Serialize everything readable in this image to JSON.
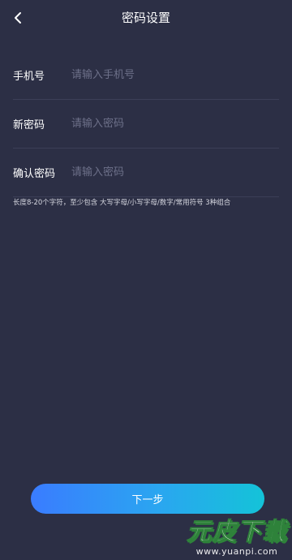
{
  "header": {
    "title": "密码设置",
    "back_icon": "chevron-left-icon"
  },
  "form": {
    "phone": {
      "label": "手机号",
      "placeholder": "请输入手机号",
      "value": ""
    },
    "new_password": {
      "label": "新密码",
      "placeholder": "请输入密码",
      "value": ""
    },
    "confirm_password": {
      "label": "确认密码",
      "placeholder": "请输入密码",
      "value": ""
    }
  },
  "hint": "长度8-20个字符，至少包含 大写字母/小写字母/数字/常用符号 3种组合",
  "next_button": {
    "label": "下一步"
  },
  "watermark": {
    "text": "元皮下载",
    "url": "www.yuanpi.com"
  },
  "colors": {
    "background": "#2c2f45",
    "divider": "#3c3f57",
    "placeholder": "#6d7089",
    "button_gradient_start": "#3a7cff",
    "button_gradient_end": "#14c3d8"
  }
}
